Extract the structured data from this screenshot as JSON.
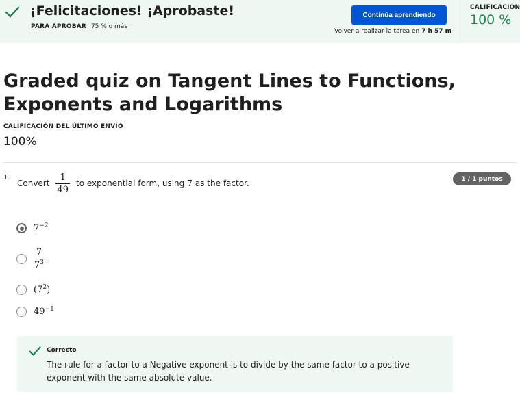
{
  "banner": {
    "title": "¡Felicitaciones! ¡Aprobaste!",
    "pass_label": "PARA APROBAR",
    "pass_value": "75 % o más",
    "continue_label": "Continúa aprendiendo",
    "retake_prefix": "Volver a realizar la tarea en",
    "retake_time": "7 h 57 m",
    "grade_label": "CALIFICACIÓN",
    "grade_value": "100 %",
    "accent_color": "#0056d2",
    "success_color": "#1f8354"
  },
  "quiz": {
    "title": "Graded quiz on Tangent Lines to Functions, Exponents and Logarithms",
    "last_submission_label": "CALIFICACIÓN DEL ÚLTIMO ENVÍO",
    "last_submission_value": "100%"
  },
  "question": {
    "number": "1.",
    "text_before": "Convert",
    "fraction_numerator": "1",
    "fraction_denominator": "49",
    "text_after_1": "to exponential form, using",
    "factor": "7",
    "text_after_2": "as the factor.",
    "points": "1 / 1 puntos",
    "options": [
      {
        "base": "7",
        "exponent": "−2",
        "selected": true
      },
      {
        "numerator": "7",
        "den_base": "7",
        "den_exponent": "3",
        "selected": false
      },
      {
        "open": "(",
        "base": "7",
        "exponent": "2",
        "close": ")",
        "selected": false
      },
      {
        "base": "49",
        "exponent": "−1",
        "selected": false
      }
    ]
  },
  "feedback": {
    "title": "Correcto",
    "text": "The rule for a factor to a Negative exponent is to divide by the same factor to a positive exponent with the same absolute value."
  }
}
